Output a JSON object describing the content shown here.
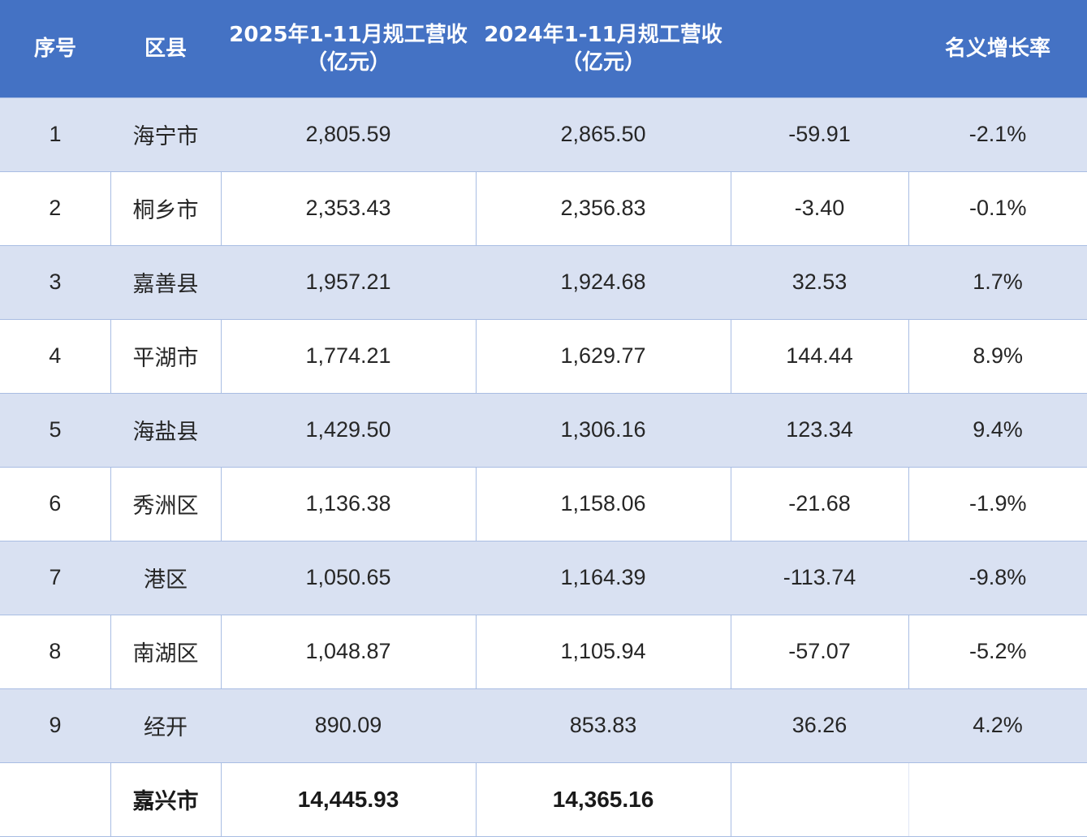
{
  "header": {
    "col_index": "序号",
    "col_district": "区县",
    "col_2025_line1": "2025年1-11月规工营收",
    "col_2025_line2": "（亿元）",
    "col_2024_line1": "2024年1-11月规工营收",
    "col_2024_line2": "（亿元）",
    "col_diff": "",
    "col_growth": "名义增长率"
  },
  "rows": [
    {
      "index": "1",
      "district": "海宁市",
      "rev2025": "2,805.59",
      "rev2024": "2,865.50",
      "diff": "-59.91",
      "growth": "-2.1%"
    },
    {
      "index": "2",
      "district": "桐乡市",
      "rev2025": "2,353.43",
      "rev2024": "2,356.83",
      "diff": "-3.40",
      "growth": "-0.1%"
    },
    {
      "index": "3",
      "district": "嘉善县",
      "rev2025": "1,957.21",
      "rev2024": "1,924.68",
      "diff": "32.53",
      "growth": "1.7%"
    },
    {
      "index": "4",
      "district": "平湖市",
      "rev2025": "1,774.21",
      "rev2024": "1,629.77",
      "diff": "144.44",
      "growth": "8.9%"
    },
    {
      "index": "5",
      "district": "海盐县",
      "rev2025": "1,429.50",
      "rev2024": "1,306.16",
      "diff": "123.34",
      "growth": "9.4%"
    },
    {
      "index": "6",
      "district": "秀洲区",
      "rev2025": "1,136.38",
      "rev2024": "1,158.06",
      "diff": "-21.68",
      "growth": "-1.9%"
    },
    {
      "index": "7",
      "district": "港区",
      "rev2025": "1,050.65",
      "rev2024": "1,164.39",
      "diff": "-113.74",
      "growth": "-9.8%"
    },
    {
      "index": "8",
      "district": "南湖区",
      "rev2025": "1,048.87",
      "rev2024": "1,105.94",
      "diff": "-57.07",
      "growth": "-5.2%"
    },
    {
      "index": "9",
      "district": "经开",
      "rev2025": "890.09",
      "rev2024": "853.83",
      "diff": "36.26",
      "growth": "4.2%"
    }
  ],
  "total": {
    "index": "",
    "district": "嘉兴市",
    "rev2025": "14,445.93",
    "rev2024": "14,365.16",
    "diff": "",
    "growth": ""
  },
  "colors": {
    "header_bg": "#4472c4",
    "band_bg": "#d9e1f2",
    "plain_bg": "#ffffff"
  }
}
